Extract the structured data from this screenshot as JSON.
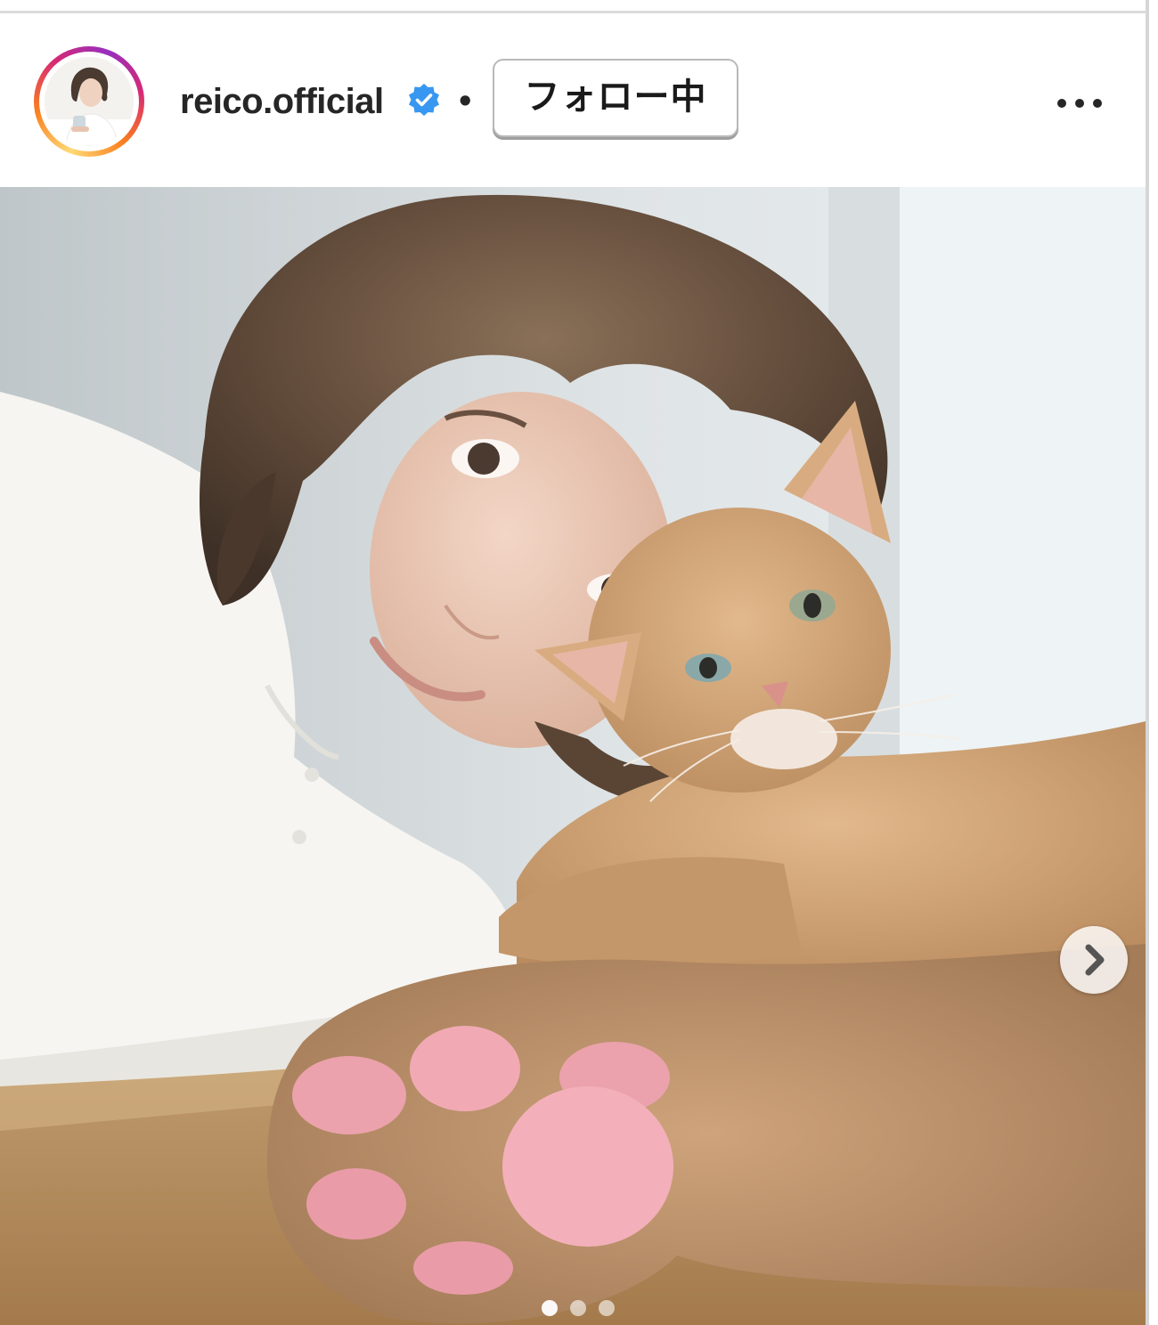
{
  "post": {
    "username": "reico.official",
    "verified": true,
    "separator": "•",
    "follow_label": "フォロー中",
    "more_icon": "more-horizontal-icon"
  },
  "carousel": {
    "total_slides": 3,
    "active_slide": 1,
    "next_icon": "chevron-right-icon"
  },
  "colors": {
    "verified_blue": "#3897f0",
    "text": "#262626",
    "story_ring": [
      "#feda75",
      "#fa7e1e",
      "#d62976",
      "#962fbf"
    ]
  }
}
